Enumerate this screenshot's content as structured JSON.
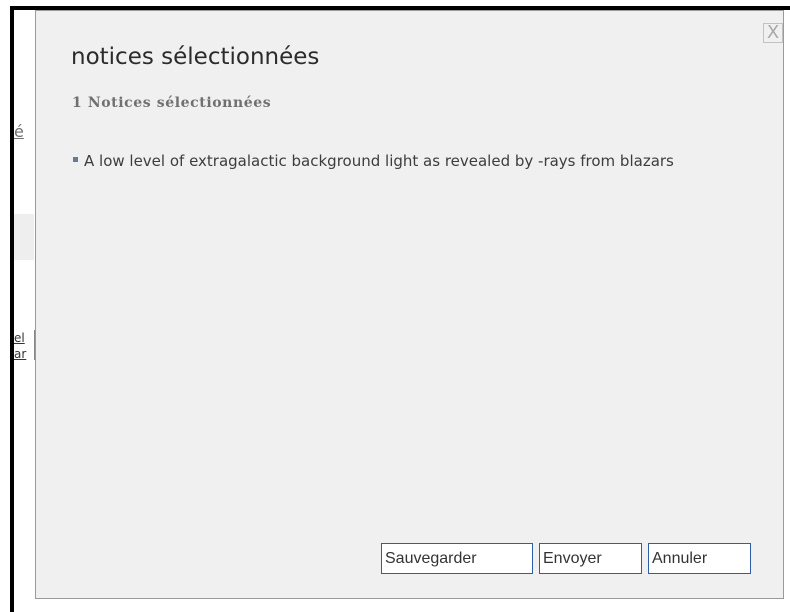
{
  "background": {
    "fragment_1": "é",
    "fragment_2": "el",
    "fragment_3": "ar"
  },
  "dialog": {
    "close_label": "X",
    "title": "notices sélectionnées",
    "subtitle": "1 Notices sélectionnées",
    "items": [
      {
        "label": "A low level of extragalactic background light as revealed by -rays from blazars"
      }
    ],
    "buttons": {
      "save": "Sauvegarder",
      "send": "Envoyer",
      "cancel": "Annuler"
    }
  },
  "colors": {
    "dialog_background": "#f0f0f0",
    "button_border": "#2d5fa8",
    "frame": "#000000"
  }
}
